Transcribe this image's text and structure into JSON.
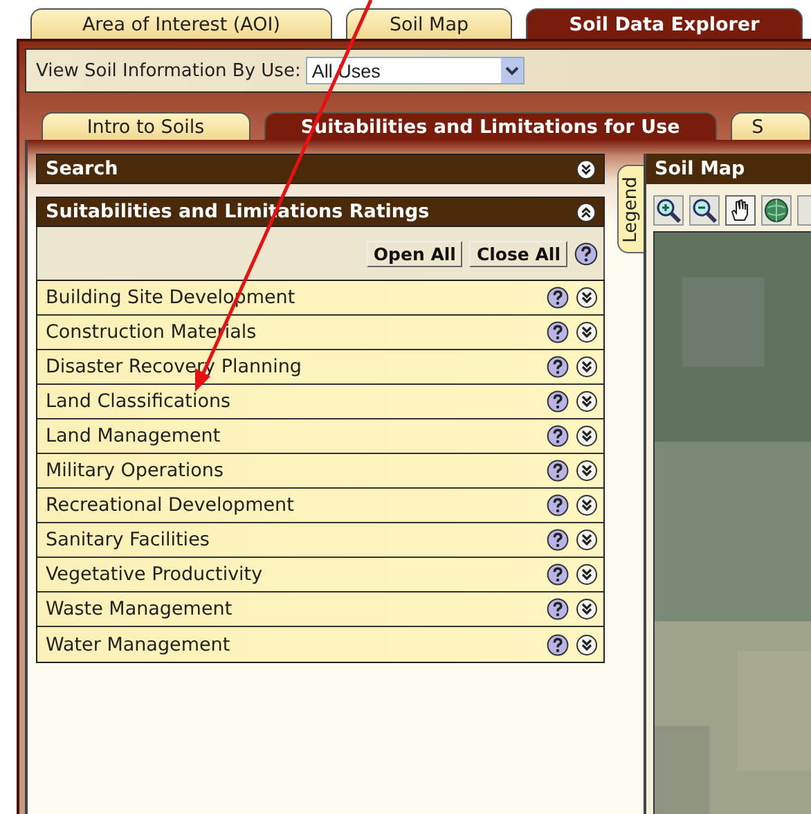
{
  "top_tabs": [
    {
      "label": "Area of Interest (AOI)",
      "selected": false
    },
    {
      "label": "Soil Map",
      "selected": false
    },
    {
      "label": "Soil Data Explorer",
      "selected": true
    }
  ],
  "view_by": {
    "label": "View Soil Information By Use:",
    "value": "All Uses"
  },
  "sub_tabs": [
    {
      "label": "Intro to Soils",
      "selected": false
    },
    {
      "label": "Suitabilities and Limitations for Use",
      "selected": true
    },
    {
      "label": "S",
      "selected": false
    }
  ],
  "search_panel": {
    "title": "Search",
    "expanded": false
  },
  "ratings_panel": {
    "title": "Suitabilities and Limitations Ratings",
    "expanded": true,
    "buttons": [
      "Open All",
      "Close All"
    ],
    "categories": [
      {
        "label": "Building Site Development",
        "expanded": false
      },
      {
        "label": "Construction Materials",
        "expanded": false
      },
      {
        "label": "Disaster Recovery Planning",
        "expanded": false
      },
      {
        "label": "Land Classifications",
        "expanded": false
      },
      {
        "label": "Land Management",
        "expanded": false
      },
      {
        "label": "Military Operations",
        "expanded": false
      },
      {
        "label": "Recreational Development",
        "expanded": false
      },
      {
        "label": "Sanitary Facilities",
        "expanded": false
      },
      {
        "label": "Vegetative Productivity",
        "expanded": false
      },
      {
        "label": "Waste Management",
        "expanded": false
      },
      {
        "label": "Water Management",
        "expanded": false
      }
    ]
  },
  "legend": {
    "label": "Legend"
  },
  "map": {
    "title": "Soil Map"
  }
}
